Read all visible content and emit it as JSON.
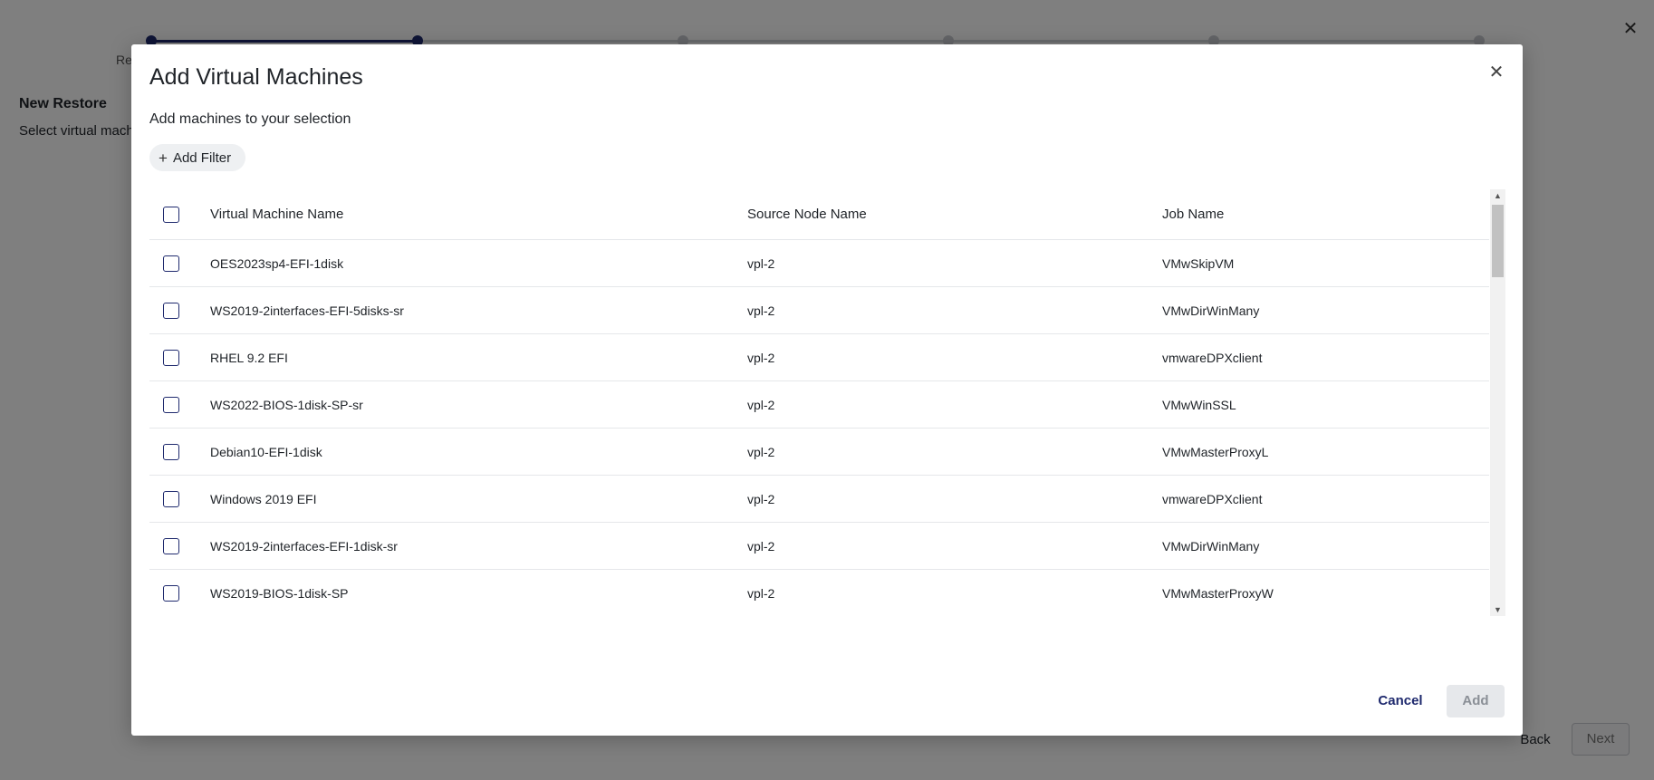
{
  "background": {
    "step_label": "Re",
    "title": "New Restore",
    "subtitle": "Select virtual machines",
    "back_label": "Back",
    "next_label": "Next",
    "close_glyph": "✕"
  },
  "modal": {
    "title": "Add Virtual Machines",
    "subtitle": "Add machines to your selection",
    "close_glyph": "✕",
    "add_filter_label": "Add Filter",
    "plus_glyph": "+",
    "table": {
      "columns": [
        "Virtual Machine Name",
        "Source Node Name",
        "Job Name"
      ],
      "rows": [
        {
          "vm": "OES2023sp4-EFI-1disk",
          "node": "vpl-2",
          "job": "VMwSkipVM"
        },
        {
          "vm": "WS2019-2interfaces-EFI-5disks-sr",
          "node": "vpl-2",
          "job": "VMwDirWinMany"
        },
        {
          "vm": "RHEL 9.2 EFI",
          "node": "vpl-2",
          "job": "vmwareDPXclient"
        },
        {
          "vm": "WS2022-BIOS-1disk-SP-sr",
          "node": "vpl-2",
          "job": "VMwWinSSL"
        },
        {
          "vm": "Debian10-EFI-1disk",
          "node": "vpl-2",
          "job": "VMwMasterProxyL"
        },
        {
          "vm": "Windows 2019 EFI",
          "node": "vpl-2",
          "job": "vmwareDPXclient"
        },
        {
          "vm": "WS2019-2interfaces-EFI-1disk-sr",
          "node": "vpl-2",
          "job": "VMwDirWinMany"
        },
        {
          "vm": "WS2019-BIOS-1disk-SP",
          "node": "vpl-2",
          "job": "VMwMasterProxyW"
        }
      ]
    },
    "scroll_up_glyph": "▲",
    "scroll_down_glyph": "▼",
    "cancel_label": "Cancel",
    "add_label": "Add"
  },
  "colors": {
    "accent": "#1f2a6e",
    "overlay": "rgba(0,0,0,0.5)",
    "disabled_bg": "#e6e8eb"
  }
}
